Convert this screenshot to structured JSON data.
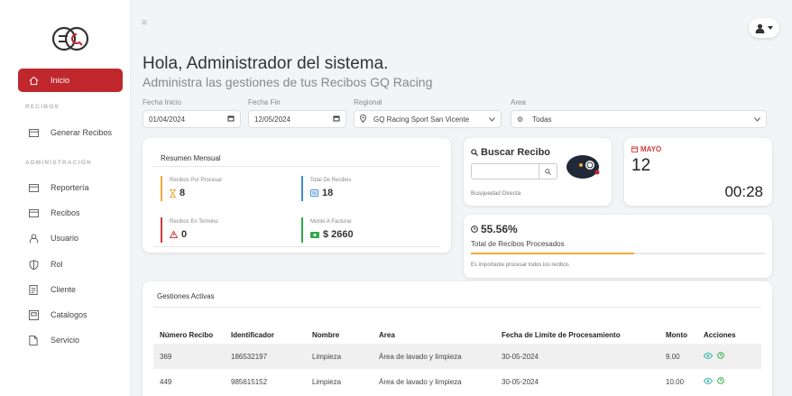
{
  "sidebar": {
    "items": [
      {
        "label": "Inicio",
        "icon": "home-icon",
        "active": true
      },
      {
        "label": "Generar Recibos",
        "icon": "card-icon"
      },
      {
        "label": "Reportería",
        "icon": "card-icon"
      },
      {
        "label": "Recibos",
        "icon": "card-icon"
      },
      {
        "label": "Usuario",
        "icon": "user-icon"
      },
      {
        "label": "Rol",
        "icon": "shield-icon"
      },
      {
        "label": "Cliente",
        "icon": "document-icon"
      },
      {
        "label": "Catalogos",
        "icon": "catalog-icon"
      },
      {
        "label": "Servicio",
        "icon": "file-icon"
      }
    ],
    "section_recibos": "RECIBOS",
    "section_admin": "ADMINISTRACIÓN"
  },
  "header": {
    "greeting": "Hola, Administrador del sistema.",
    "subtitle": "Administra las gestiones de tus Recibos GQ Racing",
    "hamburger": "≡"
  },
  "filters": {
    "start_label": "Fecha Inicio",
    "start_value": "01/04/2024",
    "end_label": "Fecha Fin",
    "end_value": "12/05/2024",
    "region_label": "Regional",
    "region_value": "GQ Racing Sport San Vicente",
    "area_label": "Area",
    "area_value": "Todas"
  },
  "summary": {
    "title": "Resumen Mensual",
    "pending_label": "Recibos Por Procesar",
    "pending_value": "8",
    "total_label": "Total De Recibos",
    "total_value": "18",
    "on_time_label": "Recibos En Termino",
    "on_time_value": "0",
    "amount_label": "Monto A Facturar",
    "amount_value": "$ 2660"
  },
  "search": {
    "title": "Buscar Recibo",
    "placeholder": "",
    "hint": "Busquedad Directa"
  },
  "calendar": {
    "month": "MAYO",
    "day": "12",
    "time": "00:28"
  },
  "progress": {
    "percent_text": "55.56%",
    "fraction": 0.5556,
    "label": "Total de Recibos Procesados",
    "note": "Es importante procesar todos los recibos"
  },
  "table": {
    "title": "Gestiones Activas",
    "headers": [
      "Número Recibo",
      "Identificador",
      "Nombre",
      "Area",
      "Fecha de Limite de Procesamiento",
      "Monto",
      "Acciones"
    ],
    "rows": [
      [
        "369",
        "186532197",
        "Limpieza",
        "Área de lavado y limpieza",
        "30-05-2024",
        "9.00"
      ],
      [
        "449",
        "985615152",
        "Limpieza",
        "Área de lavado y limpieza",
        "30-05-2024",
        "10.00"
      ]
    ]
  },
  "colors": {
    "accent": "#c0272d",
    "orange": "#f0a93a",
    "blue": "#3b8dd6",
    "green": "#2eaa4a",
    "red": "#d33a3a",
    "teal": "#2bb3a5"
  }
}
